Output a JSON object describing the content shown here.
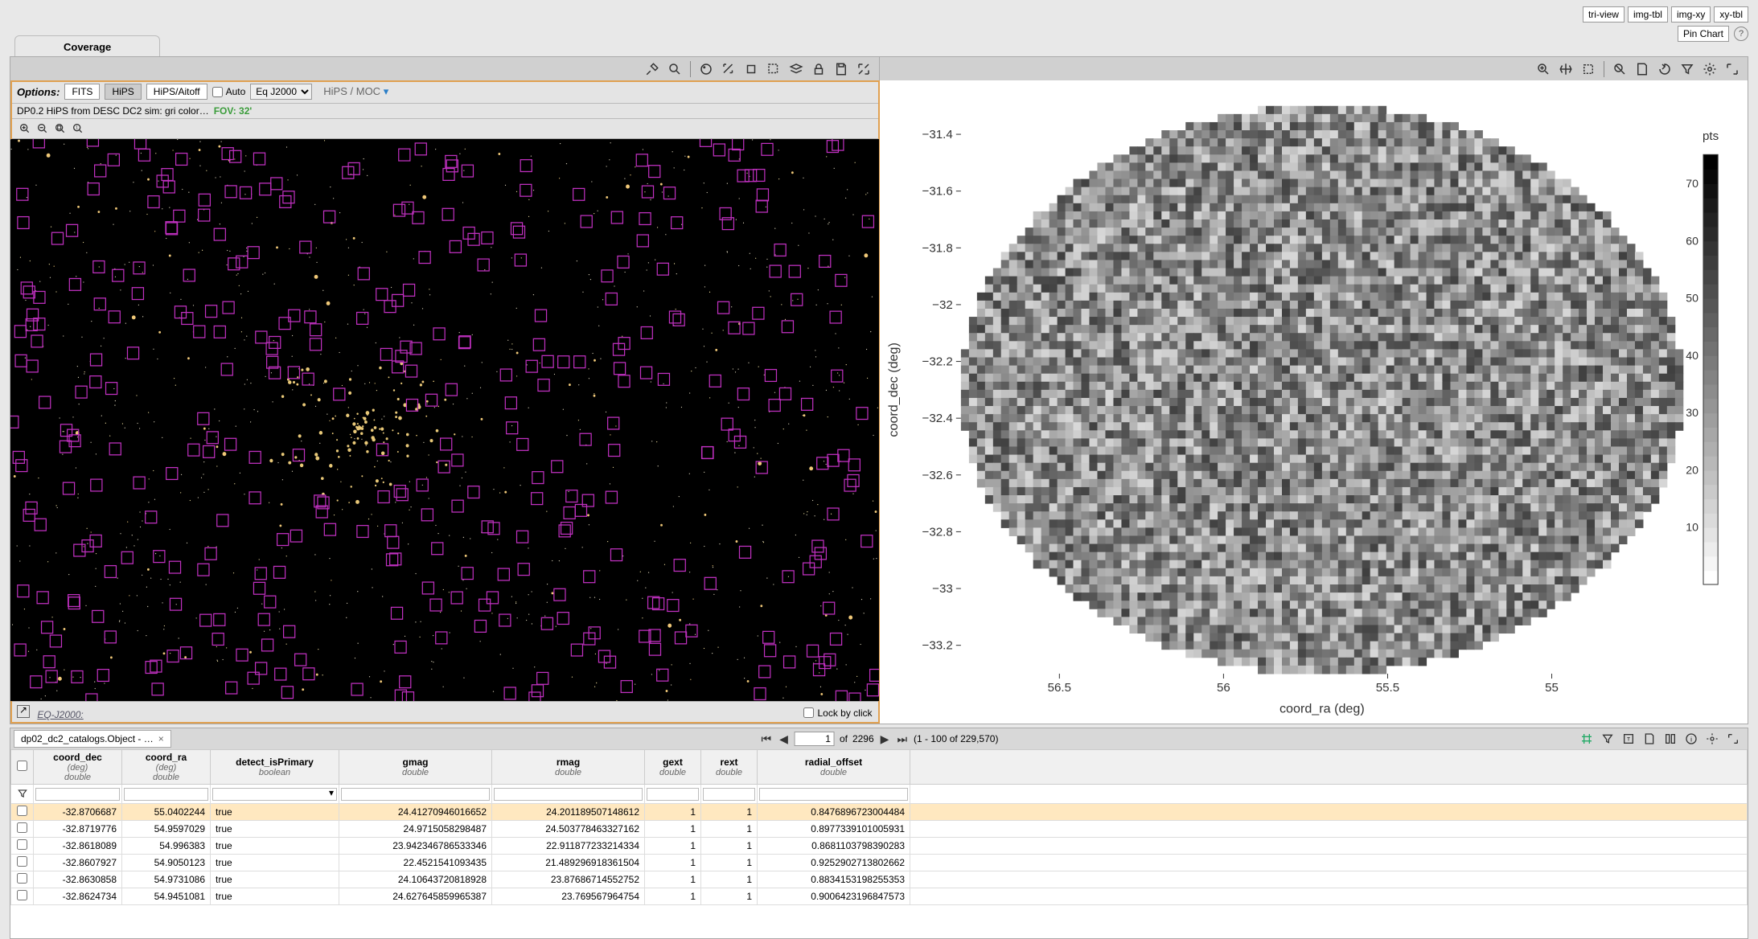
{
  "layout_buttons": [
    "tri-view",
    "img-tbl",
    "img-xy",
    "xy-tbl"
  ],
  "layout_active": "tri-view",
  "pin_label": "Pin Chart",
  "tab": {
    "label": "Coverage"
  },
  "left_panel": {
    "options_label": "Options:",
    "buttons": [
      "FITS",
      "HiPS",
      "HiPS/Aitoff"
    ],
    "buttons_selected": "HiPS",
    "auto_label": "Auto",
    "coord_select": "Eq J2000",
    "coord_options": [
      "Eq J2000"
    ],
    "moc_label": "HiPS / MOC",
    "info_text": "DP0.2 HiPS from DESC DC2 sim: gri color…",
    "fov_text": "FOV: 32'",
    "status_coord": "EQ-J2000:",
    "lock_label": "Lock by click"
  },
  "chart_data": {
    "type": "heatmap",
    "title": "",
    "xlabel": "coord_ra (deg)",
    "ylabel": "coord_dec (deg)",
    "cb_label": "pts",
    "x_ticks": [
      56.5,
      56,
      55.5,
      55
    ],
    "y_ticks": [
      -31.4,
      -31.6,
      -31.8,
      -32,
      -32.2,
      -32.4,
      -32.6,
      -32.8,
      -33,
      -33.2
    ],
    "cb_ticks": [
      10,
      20,
      30,
      40,
      50,
      60,
      70
    ],
    "xlim": [
      56.8,
      54.6
    ],
    "ylim": [
      -33.3,
      -31.3
    ],
    "cb_lim": [
      0,
      75
    ],
    "shape": "ellipse",
    "note": "2D histogram of source density; grayscale, darker = higher count"
  },
  "table": {
    "tab_label": "dp02_dc2_catalogs.Object - …",
    "pager": {
      "current": "1",
      "total_pages": "2296",
      "of_label": "of",
      "range_label": "(1 - 100 of 229,570)"
    },
    "columns": [
      {
        "name": "coord_dec",
        "unit": "(deg)",
        "type": "double"
      },
      {
        "name": "coord_ra",
        "unit": "(deg)",
        "type": "double"
      },
      {
        "name": "detect_isPrimary",
        "unit": "",
        "type": "boolean"
      },
      {
        "name": "gmag",
        "unit": "",
        "type": "double"
      },
      {
        "name": "rmag",
        "unit": "",
        "type": "double"
      },
      {
        "name": "gext",
        "unit": "",
        "type": "double"
      },
      {
        "name": "rext",
        "unit": "",
        "type": "double"
      },
      {
        "name": "radial_offset",
        "unit": "",
        "type": "double"
      }
    ],
    "rows": [
      {
        "dec": "-32.8706687",
        "ra": "55.0402244",
        "prim": "true",
        "gmag": "24.41270946016652",
        "rmag": "24.201189507148612",
        "gext": "1",
        "rext": "1",
        "off": "0.8476896723004484"
      },
      {
        "dec": "-32.8719776",
        "ra": "54.9597029",
        "prim": "true",
        "gmag": "24.9715058298487",
        "rmag": "24.503778463327162",
        "gext": "1",
        "rext": "1",
        "off": "0.8977339101005931"
      },
      {
        "dec": "-32.8618089",
        "ra": "54.996383",
        "prim": "true",
        "gmag": "23.942346786533346",
        "rmag": "22.911877233214334",
        "gext": "1",
        "rext": "1",
        "off": "0.8681103798390283"
      },
      {
        "dec": "-32.8607927",
        "ra": "54.9050123",
        "prim": "true",
        "gmag": "22.4521541093435",
        "rmag": "21.489296918361504",
        "gext": "1",
        "rext": "1",
        "off": "0.9252902713802662"
      },
      {
        "dec": "-32.8630858",
        "ra": "54.9731086",
        "prim": "true",
        "gmag": "24.10643720818928",
        "rmag": "23.87686714552752",
        "gext": "1",
        "rext": "1",
        "off": "0.8834153198255353"
      },
      {
        "dec": "-32.8624734",
        "ra": "54.9451081",
        "prim": "true",
        "gmag": "24.627645859965387",
        "rmag": "23.769567964754",
        "gext": "1",
        "rext": "1",
        "off": "0.9006423196847573"
      }
    ],
    "highlight_row": 0
  }
}
